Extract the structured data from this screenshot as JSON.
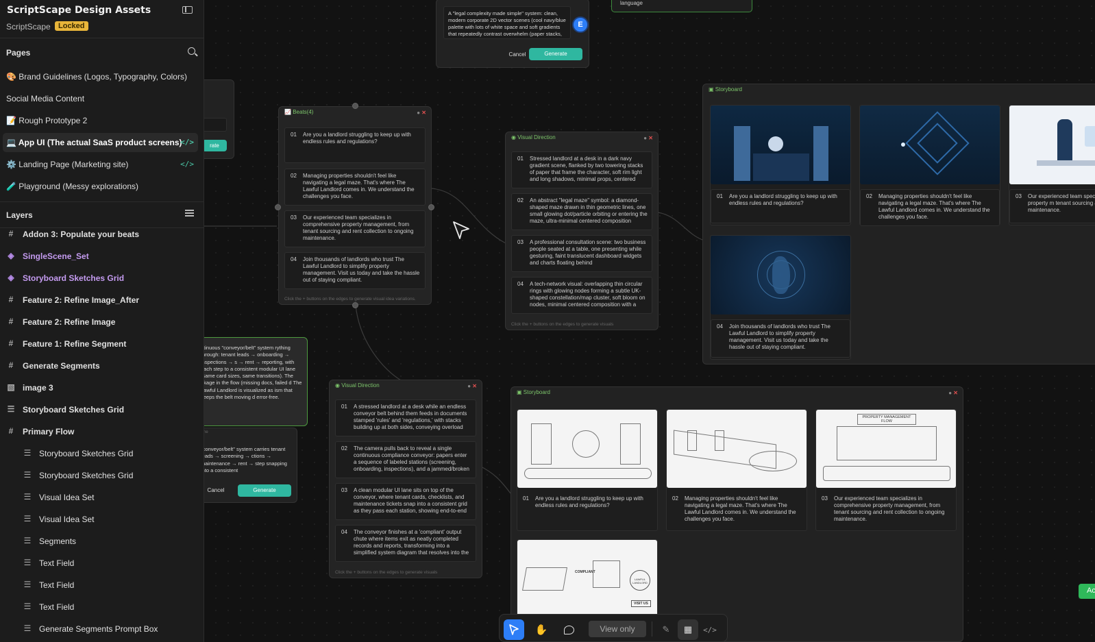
{
  "sidebar": {
    "project_title": "ScriptScape Design Assets",
    "workspace": "ScriptScape",
    "lock_badge": "Locked",
    "pages_heading": "Pages",
    "pages": [
      {
        "label": "🎨 Brand Guidelines (Logos, Typography, Colors)",
        "code": false,
        "active": false
      },
      {
        "label": "Social Media Content",
        "code": false,
        "active": false
      },
      {
        "label": "📝 Rough Prototype 2",
        "code": false,
        "active": false
      },
      {
        "label": "💻 App UI (The actual SaaS product screens)",
        "code": true,
        "active": true
      },
      {
        "label": "⚙️ Landing Page (Marketing site)",
        "code": true,
        "active": false
      },
      {
        "label": "🧪 Playground (Messy explorations)",
        "code": false,
        "active": false
      }
    ],
    "code_glyph": "</>",
    "layers_heading": "Layers",
    "layers": [
      {
        "label": "Addon 3: Populate your beats",
        "icon": "#",
        "style": "bold",
        "indent": 0
      },
      {
        "label": "SingleScene_Set",
        "icon": "◈",
        "style": "purple",
        "indent": 0
      },
      {
        "label": "Storyboard Sketches Grid",
        "icon": "◈",
        "style": "purple",
        "indent": 0
      },
      {
        "label": "Feature 2: Refine Image_After",
        "icon": "#",
        "style": "bold",
        "indent": 0
      },
      {
        "label": "Feature 2: Refine Image",
        "icon": "#",
        "style": "bold",
        "indent": 0
      },
      {
        "label": "Feature 1: Refine Segment",
        "icon": "#",
        "style": "bold",
        "indent": 0
      },
      {
        "label": "Generate Segments",
        "icon": "#",
        "style": "bold",
        "indent": 0
      },
      {
        "label": "image 3",
        "icon": "▧",
        "style": "bold",
        "indent": 0
      },
      {
        "label": "Storyboard Sketches Grid",
        "icon": "☰",
        "style": "bold",
        "indent": 0
      },
      {
        "label": "Primary Flow",
        "icon": "#",
        "style": "bold",
        "indent": 0
      },
      {
        "label": "Storyboard Sketches Grid",
        "icon": "☰",
        "style": "normal",
        "indent": 1
      },
      {
        "label": "Storyboard Sketches Grid",
        "icon": "☰",
        "style": "normal",
        "indent": 1
      },
      {
        "label": "Visual Idea Set",
        "icon": "☰",
        "style": "normal",
        "indent": 1
      },
      {
        "label": "Visual Idea Set",
        "icon": "☰",
        "style": "normal",
        "indent": 1
      },
      {
        "label": "Segments",
        "icon": "☰",
        "style": "normal",
        "indent": 1
      },
      {
        "label": "Text Field",
        "icon": "☰",
        "style": "normal",
        "indent": 1
      },
      {
        "label": "Text Field",
        "icon": "☰",
        "style": "normal",
        "indent": 1
      },
      {
        "label": "Text Field",
        "icon": "☰",
        "style": "normal",
        "indent": 1
      },
      {
        "label": "Generate Segments Prompt Box",
        "icon": "☰",
        "style": "normal",
        "indent": 1
      }
    ]
  },
  "prompt_top": {
    "text": "A \"legal complexity made simple\" system: clean, modern corporate 2D vector scenes (cool navy/blue palette with lots of white space and soft gradients that repeatedly contrast overwhelm (paper stacks,",
    "avatar": "E",
    "cancel": "Cancel",
    "generate": "Generate",
    "green_box_text": "language"
  },
  "prompt_left": {
    "text": "ntinuous \"conveyor/belt\" system rything through: tenant leads → onboarding → inspections → s → rent → reporting, with each step to a consistent modular UI lane (same card sizes, same transitions). The akage in the flow (missing docs, failed d The Lawful Landlord is visualized as ism that keeps the belt moving d error-free.",
    "sub_label": "ne",
    "text2": "\"conveyor/belt\" system carries tenant leads → screening → ctions → maintenance → rent → step snapping into a consistent",
    "cancel": "Cancel",
    "generate": "Generate",
    "partial_btn": "rate"
  },
  "beats_node": {
    "title": "Beats(4)",
    "items": [
      {
        "num": "01",
        "text": "Are you a landlord struggling to keep up with endless rules and regulations?"
      },
      {
        "num": "02",
        "text": "Managing properties shouldn't feel like navigating a legal maze. That's where The Lawful Landlord comes in. We understand the challenges you face."
      },
      {
        "num": "03",
        "text": "Our experienced team specializes in comprehensive property management, from tenant sourcing and rent collection to ongoing maintenance."
      },
      {
        "num": "04",
        "text": "Join thousands of landlords who trust The Lawful Landlord to simplify property management. Visit us today and take the hassle out of staying compliant."
      }
    ],
    "footer": "Click the + buttons on the edges to generate visual idea variations."
  },
  "visual_direction_1": {
    "title": "Visual Direction",
    "items": [
      {
        "num": "01",
        "text": "Stressed landlord at a desk in a dark navy gradient scene, flanked by two towering stacks of paper that frame the character, soft rim light and long shadows, minimal props, centered"
      },
      {
        "num": "02",
        "text": "An abstract \"legal maze\" symbol: a diamond-shaped maze drawn in thin geometric lines, one small glowing dot/particle orbiting or entering the maze, ultra-minimal centered composition"
      },
      {
        "num": "03",
        "text": "A professional consultation scene: two business people seated at a table, one presenting while gesturing, faint translucent dashboard widgets and charts floating behind"
      },
      {
        "num": "04",
        "text": "A tech-network visual: overlapping thin circular rings with glowing nodes forming a subtle UK-shaped constellation/map cluster, soft bloom on nodes, minimal centered composition with a"
      }
    ],
    "footer": "Click the + buttons on the edges to generate visuals"
  },
  "visual_direction_2": {
    "title": "Visual Direction",
    "items": [
      {
        "num": "01",
        "text": "A stressed landlord at a desk while an endless conveyor belt behind them feeds in documents stamped 'rules' and 'regulations,' with stacks building up at both sides, conveying overload"
      },
      {
        "num": "02",
        "text": "The camera pulls back to reveal a single continuous compliance conveyor: papers enter a sequence of labeled stations (screening, onboarding, inspections), and a jammed/broken"
      },
      {
        "num": "03",
        "text": "A clean modular UI lane sits on top of the conveyor, where tenant cards, checklists, and maintenance tickets snap into a consistent grid as they pass each station, showing end-to-end"
      },
      {
        "num": "04",
        "text": "The conveyor finishes at a 'compliant' output chute where items exit as neatly completed records and reports, transforming into a simplified system diagram that resolves into the"
      }
    ],
    "footer": "Click the + buttons on the edges to generate visuals"
  },
  "storyboard_1": {
    "title": "Storyboard",
    "captions": [
      {
        "num": "01",
        "text": "Are you a landlord struggling to keep up with endless rules and regulations?"
      },
      {
        "num": "02",
        "text": "Managing properties shouldn't feel like navigating a legal maze. That's where The Lawful Landlord comes in. We understand the challenges you face."
      },
      {
        "num": "03",
        "text": "Our experienced team speci comprehensive property m tenant sourcing and rent col maintenance."
      },
      {
        "num": "04",
        "text": "Join thousands of landlords who trust The Lawful Landlord to simplify property management. Visit us today and take the hassle out of staying compliant."
      }
    ]
  },
  "storyboard_2": {
    "title": "Storyboard",
    "captions": [
      {
        "num": "01",
        "text": "Are you a landlord struggling to keep up with endless rules and regulations?"
      },
      {
        "num": "02",
        "text": "Managing properties shouldn't feel like navigating a legal maze. That's where The Lawful Landlord comes in. We understand the challenges you face."
      },
      {
        "num": "03",
        "text": "Our experienced team specializes in comprehensive property management, from tenant sourcing and rent collection to ongoing maintenance."
      }
    ],
    "sketch_labels": {
      "flow_title": "PROPERTY MANAGEMENT FLOW",
      "compliant": "COMPLIANT",
      "visit": "VISIT US",
      "logo": "LAWFUL LANDLORD"
    }
  },
  "toolbar": {
    "view_only": "View only"
  },
  "edge_button": "Ac",
  "colors": {
    "accent": "#2fb7a0",
    "active_tool": "#2d7ef7",
    "badge": "#e8b53a",
    "node_title": "#7dc56b"
  }
}
